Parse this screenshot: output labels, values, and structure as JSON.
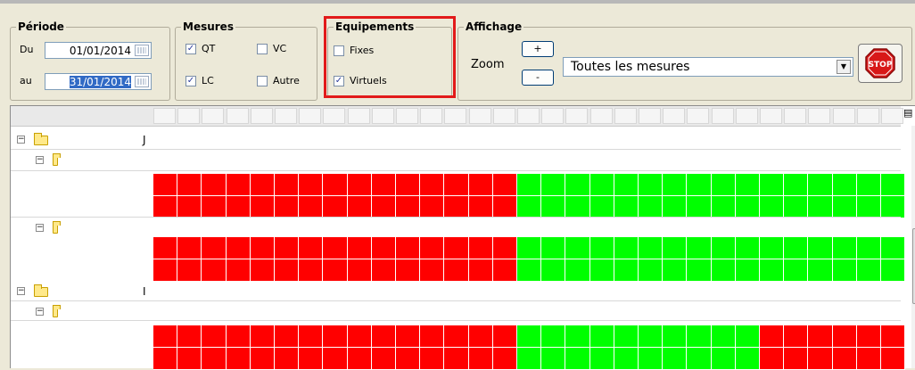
{
  "periode": {
    "legend": "Période",
    "du_label": "Du",
    "du_value": "01/01/2014",
    "au_label": "au",
    "au_value": "31/01/2014"
  },
  "mesures": {
    "legend": "Mesures",
    "qt": "QT",
    "lc": "LC",
    "vc": "VC",
    "autre": "Autre"
  },
  "equipements": {
    "legend": "Equipements",
    "fixes": "Fixes",
    "virtuels": "Virtuels"
  },
  "affichage": {
    "legend": "Affichage",
    "zoom_label": "Zoom",
    "zoom_in": "+",
    "zoom_out": "-",
    "select_value": "Toutes les mesures",
    "stop_label": "STOP"
  },
  "tree": {
    "row1_marker": "J",
    "row6_marker": "I"
  },
  "grid": {
    "data_rows": [
      {
        "red": 15,
        "green": 16
      },
      {
        "red": 15,
        "green": 16
      },
      {
        "red": 15,
        "green": 16
      },
      {
        "red": 15,
        "green": 16
      },
      {
        "red": 15,
        "green": 10,
        "red_tail": 6
      },
      {
        "red": 15,
        "green": 10,
        "red_tail": 6
      }
    ],
    "colors": {
      "ok": "#00ff00",
      "ko": "#ff0000"
    }
  }
}
